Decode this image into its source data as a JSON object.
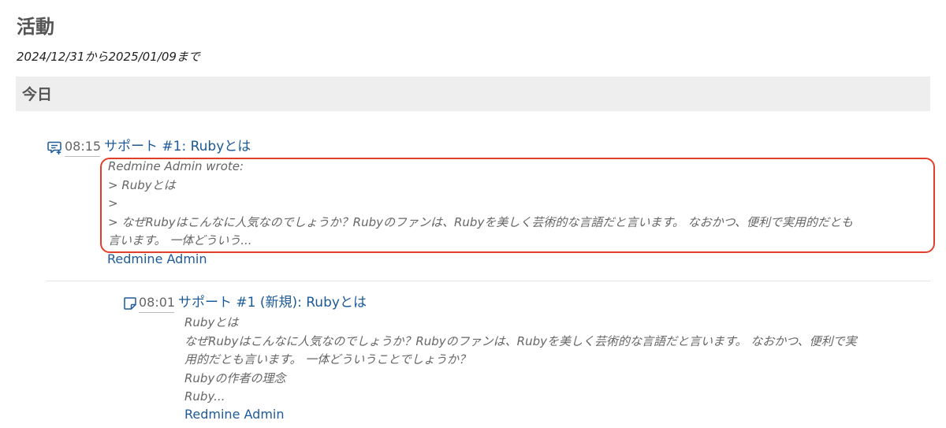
{
  "page": {
    "title": "活動",
    "date_range": "2024/12/31から2025/01/09まで"
  },
  "day": {
    "label": "今日"
  },
  "entries": [
    {
      "icon": "reply-comment-icon",
      "time": "08:15",
      "title": "サポート #1: Rubyとは",
      "description_lines": [
        "Redmine Admin wrote:",
        "> Rubyとは",
        ">",
        "> なぜRubyはこんなに人気なのでしょうか？Rubyのファンは、Rubyを美しく芸術的な言語だと言います。 なおかつ、便利で実用的だとも",
        "言います。 一体どういう..."
      ],
      "author": "Redmine Admin"
    },
    {
      "icon": "note-icon",
      "time": "08:01",
      "title": "サポート #1 (新規): Rubyとは",
      "description_lines": [
        "Rubyとは",
        "なぜRubyはこんなに人気なのでしょうか？Rubyのファンは、Rubyを美しく芸術的な言語だと言います。 なおかつ、便利で実",
        "用的だとも言います。 一体どういうことでしょうか？",
        "Rubyの作者の理念",
        "Ruby..."
      ],
      "author": "Redmine Admin"
    }
  ],
  "colors": {
    "link": "#1d5a97",
    "highlight_border": "#e0402a",
    "day_header_bg": "#eeeeee"
  }
}
